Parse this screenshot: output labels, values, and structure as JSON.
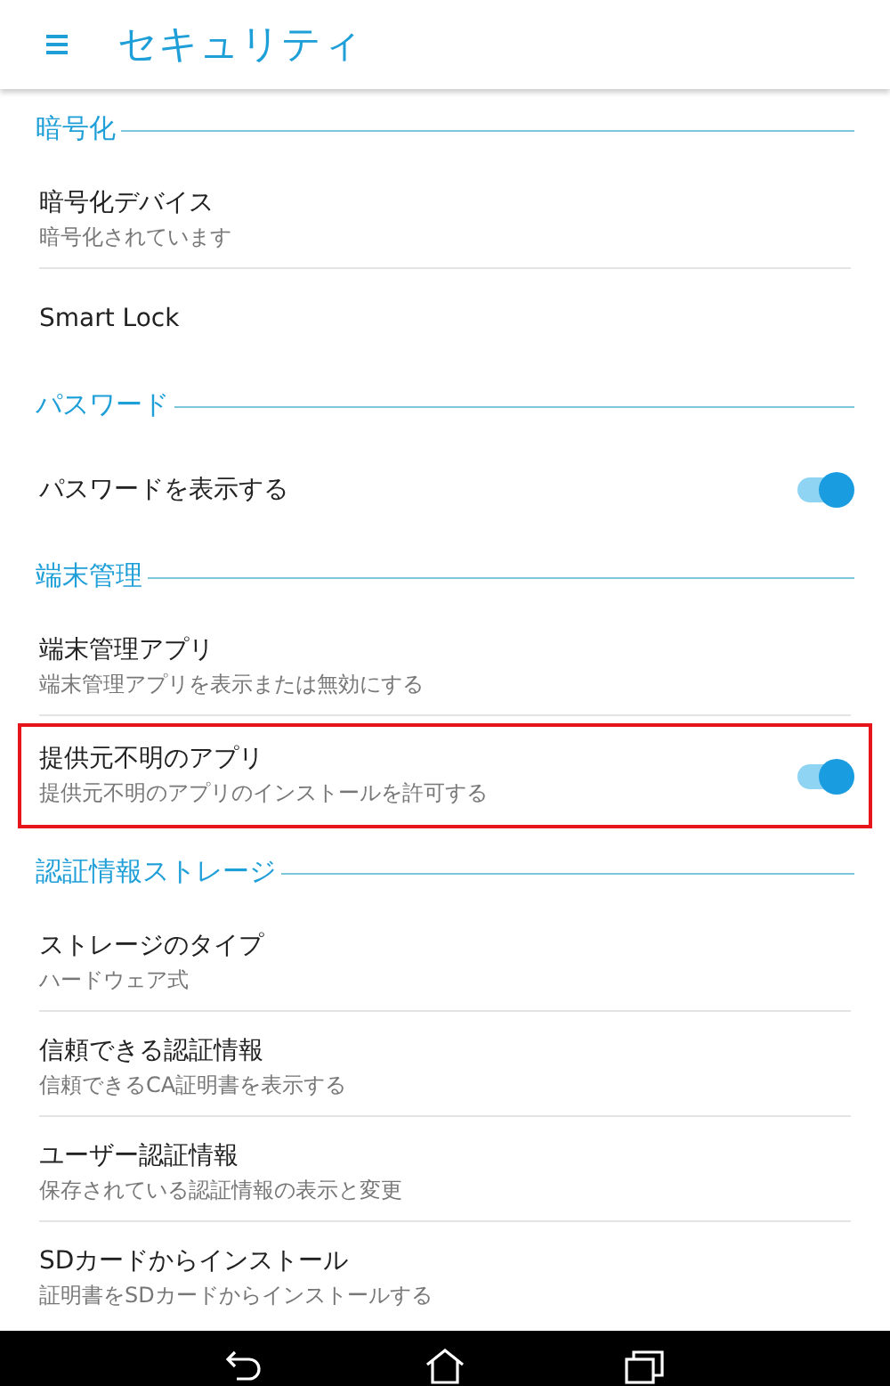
{
  "header": {
    "title": "セキュリティ"
  },
  "sections": [
    {
      "title": "暗号化",
      "items": [
        {
          "kind": "text",
          "title": "暗号化デバイス",
          "subtitle": "暗号化されています",
          "highlighted": false
        },
        {
          "kind": "text",
          "title": "Smart Lock",
          "highlighted": false
        }
      ]
    },
    {
      "title": "パスワード",
      "items": [
        {
          "kind": "toggle",
          "title": "パスワードを表示する",
          "on": true,
          "highlighted": false
        }
      ]
    },
    {
      "title": "端末管理",
      "items": [
        {
          "kind": "text",
          "title": "端末管理アプリ",
          "subtitle": "端末管理アプリを表示または無効にする",
          "highlighted": false
        },
        {
          "kind": "toggle",
          "title": "提供元不明のアプリ",
          "subtitle": "提供元不明のアプリのインストールを許可する",
          "on": true,
          "highlighted": true
        }
      ]
    },
    {
      "title": "認証情報ストレージ",
      "items": [
        {
          "kind": "text",
          "title": "ストレージのタイプ",
          "subtitle": "ハードウェア式",
          "highlighted": false
        },
        {
          "kind": "text",
          "title": "信頼できる認証情報",
          "subtitle": "信頼できるCA証明書を表示する",
          "highlighted": false
        },
        {
          "kind": "text",
          "title": "ユーザー認証情報",
          "subtitle": "保存されている認証情報の表示と変更",
          "highlighted": false
        },
        {
          "kind": "text",
          "title": "SDカードからインストール",
          "subtitle": "証明書をSDカードからインストールする",
          "highlighted": false
        }
      ]
    }
  ]
}
